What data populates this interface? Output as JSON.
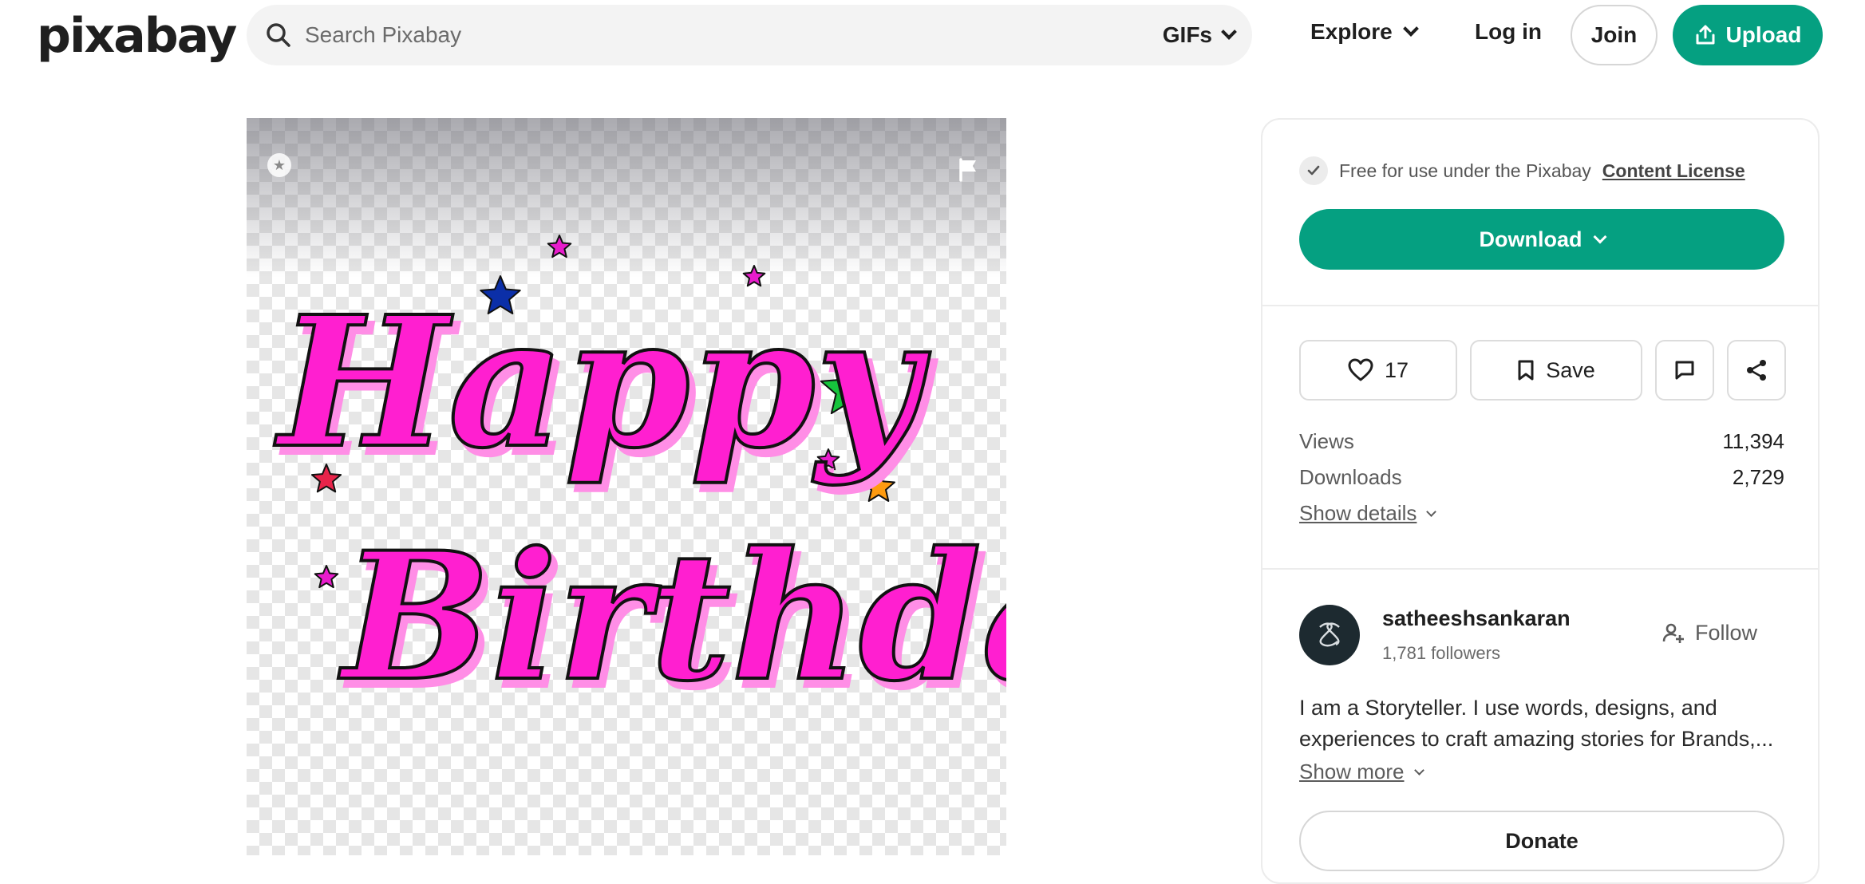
{
  "header": {
    "logo": "pixabay",
    "search_placeholder": "Search Pixabay",
    "media_type": "GIFs",
    "explore_label": "Explore",
    "login_label": "Log in",
    "join_label": "Join",
    "upload_label": "Upload"
  },
  "image": {
    "line1": "Happy",
    "line2": "Birthday",
    "colors": {
      "text": "#ff1fd0",
      "shadow": "#ff8ee6",
      "star_blue": "#0b2fa8",
      "star_green": "#16c43c",
      "star_red": "#e8244a",
      "star_orange": "#ff9b10",
      "star_magenta": "#e81ccc"
    }
  },
  "sidebar": {
    "license_text": "Free for use under the Pixabay",
    "license_link": "Content License",
    "download_label": "Download",
    "likes_count": "17",
    "save_label": "Save",
    "stats": [
      {
        "label": "Views",
        "value": "11,394"
      },
      {
        "label": "Downloads",
        "value": "2,729"
      }
    ],
    "show_details_label": "Show details",
    "author": {
      "username": "satheeshsankaran",
      "followers": "1,781 followers",
      "follow_label": "Follow",
      "bio": "I am a Storyteller. I use words, designs, and experiences to craft amazing stories for Brands,...",
      "show_more_label": "Show more",
      "donate_label": "Donate"
    }
  },
  "colors": {
    "accent": "#05a081"
  }
}
